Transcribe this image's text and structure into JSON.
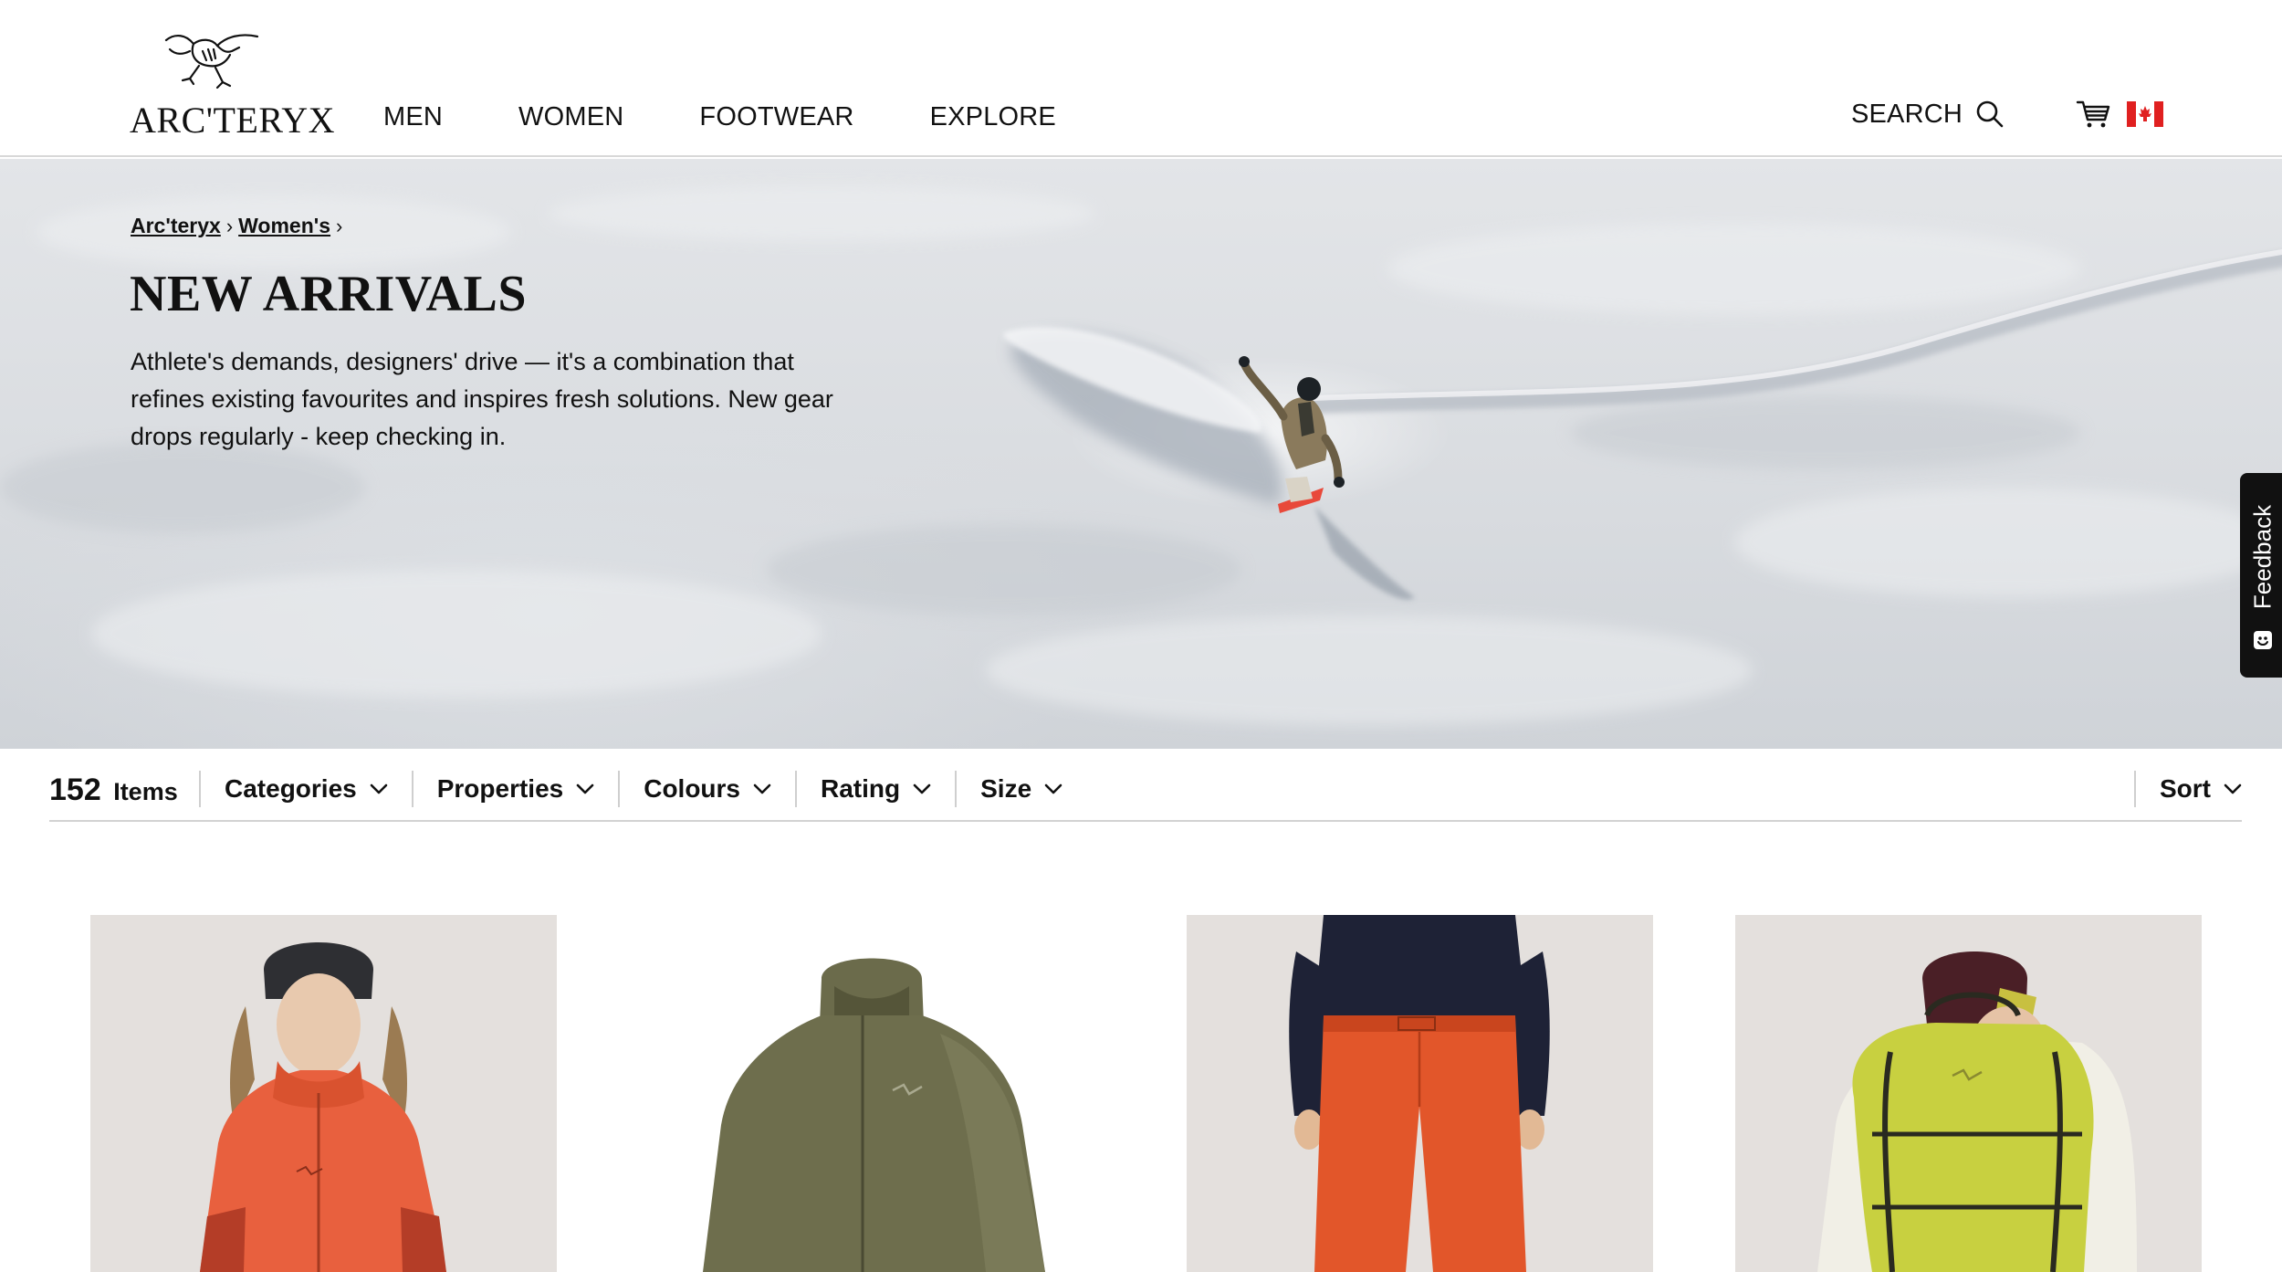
{
  "header": {
    "logo_text": "ARC'TERYX",
    "nav": [
      "MEN",
      "WOMEN",
      "FOOTWEAR",
      "EXPLORE"
    ],
    "search_label": "SEARCH",
    "icons": {
      "search": "search-icon",
      "cart": "cart-icon",
      "flag": "canada-flag-icon"
    }
  },
  "hero": {
    "breadcrumb": [
      "Arc'teryx",
      "Women's"
    ],
    "title": "NEW ARRIVALS",
    "description": "Athlete's demands, designers' drive — it's a combination that refines existing favourites and inspires fresh solutions. New gear drops regularly - keep checking in."
  },
  "feedback": {
    "label": "Feedback"
  },
  "filter_bar": {
    "count": "152",
    "count_label": "Items",
    "filters": [
      "Categories",
      "Properties",
      "Colours",
      "Rating",
      "Size"
    ],
    "sort_label": "Sort"
  },
  "colors": {
    "text": "#111111",
    "accent_red": "#e8492f",
    "flag_red": "#e02020"
  },
  "products": [
    {
      "name": "orange-shell-jacket",
      "color": "#e8603e"
    },
    {
      "name": "olive-insulated-jacket",
      "color": "#6b6b4b"
    },
    {
      "name": "orange-ski-pants",
      "color": "#e2562a"
    },
    {
      "name": "lime-backpack",
      "color": "#c8d040"
    }
  ]
}
